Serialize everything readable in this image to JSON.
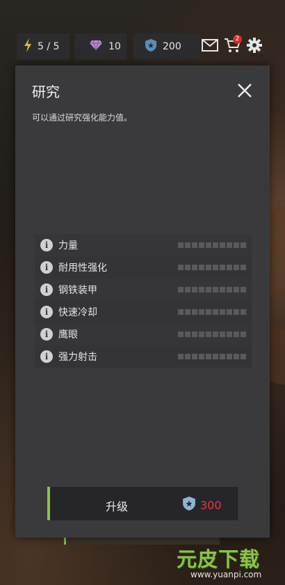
{
  "hud": {
    "energy": "5 / 5",
    "gems": "10",
    "tokens": "200",
    "mail_badge": "2",
    "colors": {
      "energy": "#e2b53a",
      "gem": "#b98ad6",
      "token": "#5a8fb3"
    }
  },
  "dialog": {
    "title": "研究",
    "description": "可以通过研究强化能力值。",
    "stats": [
      {
        "label": "力量"
      },
      {
        "label": "耐用性强化"
      },
      {
        "label": "钢铁装甲"
      },
      {
        "label": "快速冷却"
      },
      {
        "label": "鹰眼"
      },
      {
        "label": "强力射击"
      }
    ],
    "upgrade": {
      "label": "升级",
      "cost": "300",
      "accent": "#8bc34a",
      "cost_color": "#e53935"
    }
  },
  "watermark": {
    "logo": "元皮下载",
    "url": "www.yuanpi.com"
  }
}
